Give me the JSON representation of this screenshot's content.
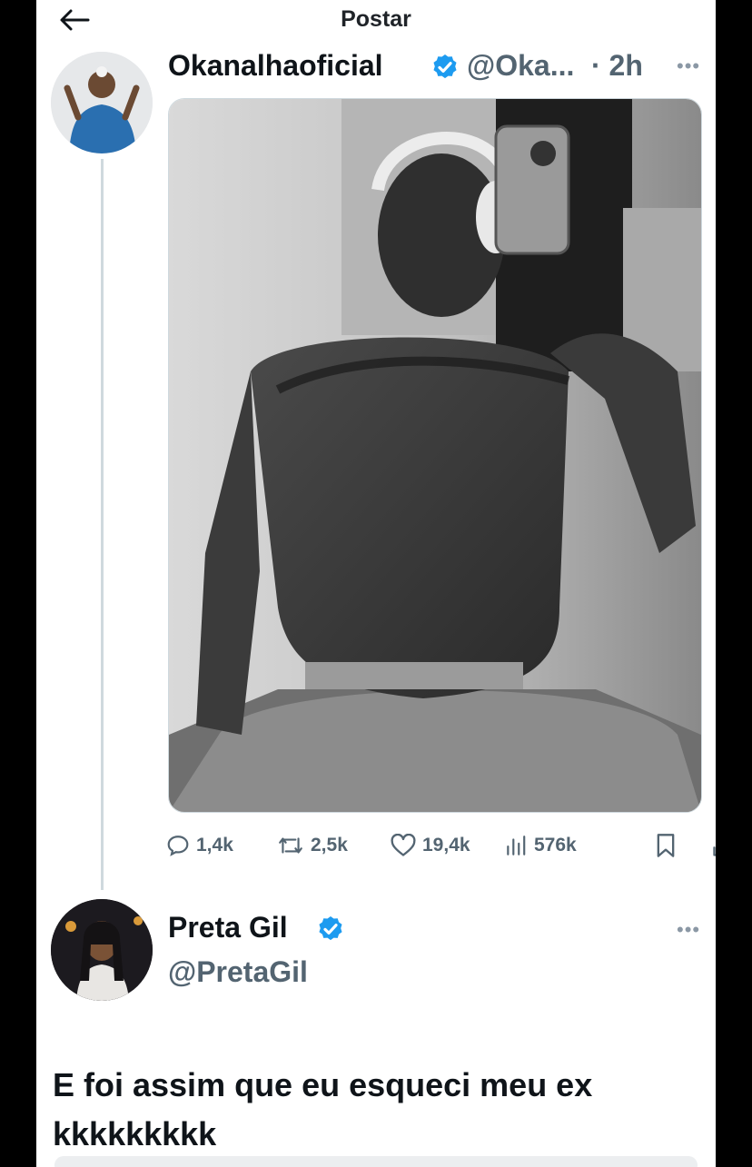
{
  "header": {
    "title": "Postar"
  },
  "post": {
    "author_name": "Okanalhaoficial",
    "author_handle": "@Oka...",
    "time": "· 2h",
    "media_alt": "Foto em preto e branco",
    "stats": {
      "replies": "1,4k",
      "reposts": "2,5k",
      "likes": "19,4k",
      "views": "576k"
    }
  },
  "reply": {
    "author_name": "Preta Gil",
    "author_handle": "@PretaGil",
    "text_line1": "E foi assim que eu esqueci meu ex",
    "text_line2": "kkkkkkkkk"
  },
  "colors": {
    "verified": "#1d9bf0",
    "muted": "#536471",
    "thread_line": "#cfd9de"
  }
}
